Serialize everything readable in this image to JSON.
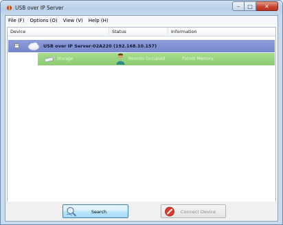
{
  "window": {
    "title": "USB over IP Server"
  },
  "menu": [
    "File (F)",
    "Options (O)",
    "View (V)",
    "Help (H)"
  ],
  "columns": [
    "Device",
    "Status",
    "Information"
  ],
  "server": {
    "expander": "−",
    "label": "USB over IP Server-02A220  (192.168.10.157)"
  },
  "device": {
    "name": "Storage",
    "status": "Remote Occupied",
    "info": "Patriot Memory"
  },
  "buttons": {
    "search": "Search",
    "connect": "Connect Device"
  },
  "colors": {
    "server_row": "#7f91d2",
    "device_row": "#9ad47e",
    "accent": "#3c7fb1"
  }
}
